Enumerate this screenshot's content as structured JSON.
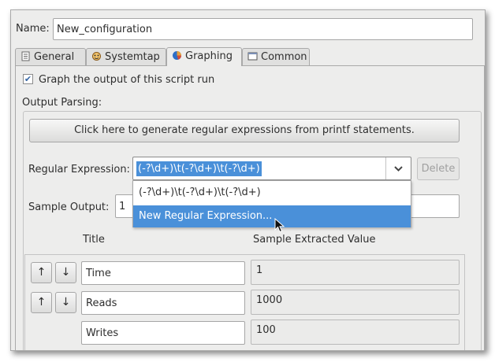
{
  "name": {
    "label": "Name:",
    "value": "New_configuration"
  },
  "tabs": [
    {
      "label": "General",
      "icon": "document-icon"
    },
    {
      "label": "Systemtap",
      "icon": "systemtap-icon"
    },
    {
      "label": "Graphing",
      "icon": "pie-chart-icon"
    },
    {
      "label": "Common",
      "icon": "window-icon"
    }
  ],
  "active_tab": "Graphing",
  "graph_checkbox": {
    "label": "Graph the output of this script run",
    "checked": true
  },
  "output_parsing": {
    "group_label": "Output Parsing:",
    "generate_button": "Click here to generate regular expressions from printf statements.",
    "regex_label": "Regular Expression:",
    "regex_value": "(-?\\d+)\\t(-?\\d+)\\t(-?\\d+)",
    "delete_button": "Delete",
    "dropdown_items": [
      "(-?\\d+)\\t(-?\\d+)\\t(-?\\d+)",
      "New Regular Expression..."
    ],
    "sample_label": "Sample Output:",
    "sample_value": "1"
  },
  "columns": {
    "title": "Title",
    "sample": "Sample Extracted Value"
  },
  "rows": [
    {
      "title": "Time",
      "value": "1"
    },
    {
      "title": "Reads",
      "value": "1000"
    },
    {
      "title": "Writes",
      "value": "100"
    }
  ],
  "glyphs": {
    "up": "↑",
    "down": "↓",
    "check": "✔"
  },
  "colors": {
    "selection": "#4a90d9",
    "window_bg": "#ededec"
  }
}
